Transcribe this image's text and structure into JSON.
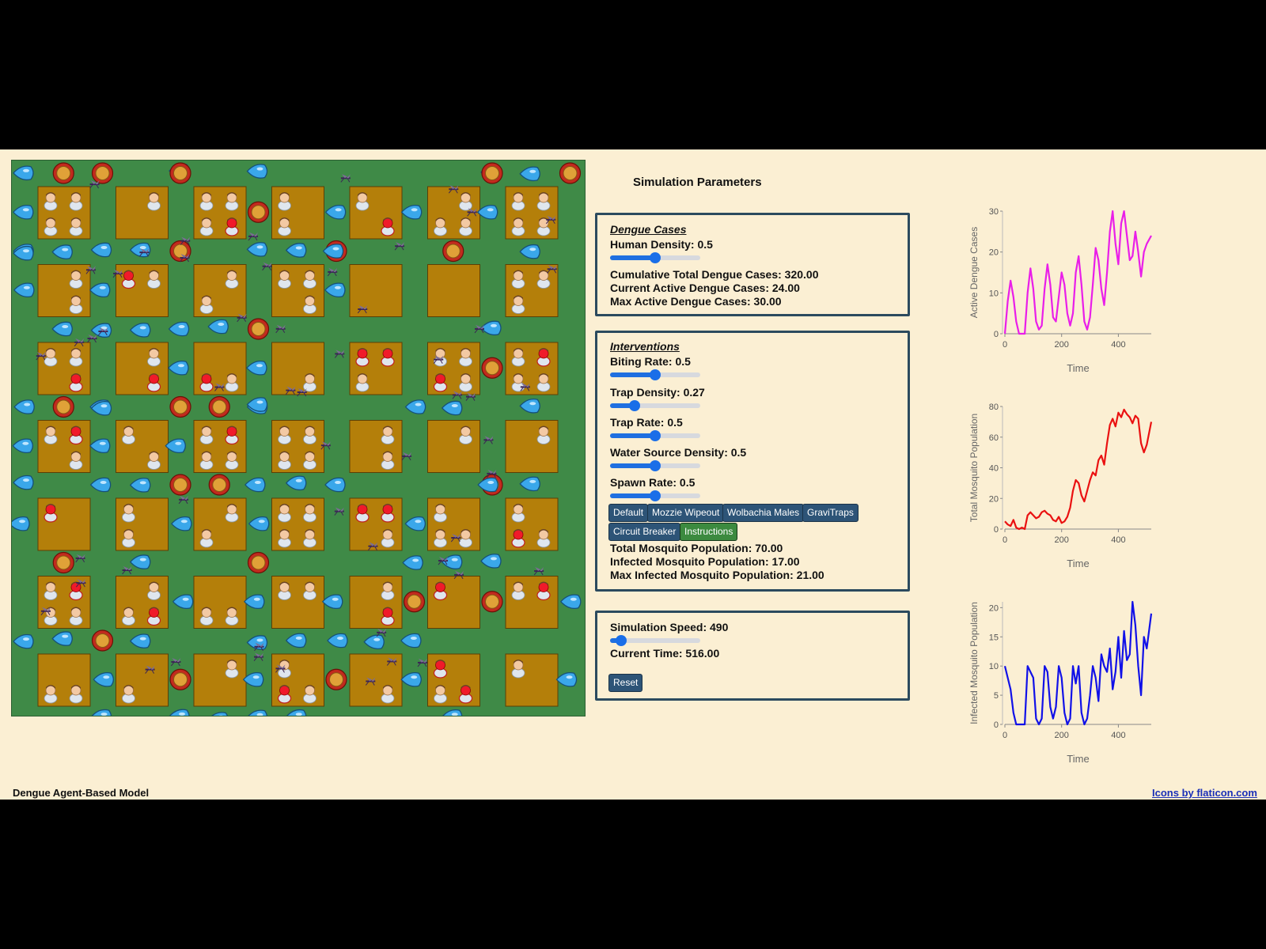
{
  "simulation_title": "Simulation Parameters",
  "dengue_cases": {
    "title": "Dengue Cases",
    "human_density": {
      "label": "Human Density: 0.5",
      "value": 0.5
    },
    "cumulative": "Cumulative Total Dengue Cases: 320.00",
    "active": "Current Active Dengue Cases: 24.00",
    "max_active": "Max Active Dengue Cases: 30.00"
  },
  "interventions": {
    "title": "Interventions",
    "biting_rate": {
      "label": "Biting Rate: 0.5",
      "value": 0.5
    },
    "trap_density": {
      "label": "Trap Density: 0.27",
      "value": 0.27
    },
    "trap_rate": {
      "label": "Trap Rate: 0.5",
      "value": 0.5
    },
    "water_source_density": {
      "label": "Water Source Density: 0.5",
      "value": 0.5
    },
    "spawn_rate": {
      "label": "Spawn Rate: 0.5",
      "value": 0.5
    },
    "buttons": [
      "Default",
      "Mozzie Wipeout",
      "Wolbachia Males",
      "GraviTraps",
      "Circuit Breaker",
      "Instructions"
    ],
    "total_mosquito": "Total Mosquito Population: 70.00",
    "infected_mosquito": "Infected Mosquito Population: 17.00",
    "max_infected_mosquito": "Max Infected Mosquito Population: 21.00"
  },
  "speed_panel": {
    "speed": {
      "label": "Simulation Speed: 490",
      "fraction": 0.12
    },
    "current_time": "Current Time: 516.00",
    "reset": "Reset"
  },
  "footer": {
    "left": "Dengue Agent-Based Model",
    "right": "Icons by flaticon.com"
  },
  "colors": {
    "grass": "#3f8a47",
    "house": "#b47f0a",
    "panel_border": "#2b4a5e",
    "button": "#2d5477",
    "button_active": "#3c8a3f",
    "slider": "#1a6ee8"
  },
  "icons": [
    "person-icon",
    "infected-person-icon",
    "water-drop-icon",
    "trap-icon",
    "mosquito-icon"
  ],
  "chart_data": [
    {
      "type": "line",
      "ylabel": "Active Dengue Cases",
      "xlabel": "Time",
      "color": "#e91ee9",
      "xlim": [
        0,
        516
      ],
      "ylim": [
        0,
        30
      ],
      "xticks": [
        0,
        200,
        400
      ],
      "yticks": [
        0,
        10,
        20,
        30
      ],
      "x": [
        0,
        10,
        20,
        30,
        40,
        50,
        60,
        70,
        80,
        90,
        100,
        110,
        120,
        130,
        140,
        150,
        160,
        170,
        180,
        190,
        200,
        210,
        220,
        230,
        240,
        250,
        260,
        270,
        280,
        290,
        300,
        310,
        320,
        330,
        340,
        350,
        360,
        370,
        380,
        390,
        400,
        410,
        420,
        430,
        440,
        450,
        460,
        470,
        480,
        490,
        500,
        516
      ],
      "y": [
        0,
        8,
        13,
        9,
        3,
        0,
        0,
        0,
        10,
        16,
        11,
        3,
        1,
        2,
        11,
        17,
        12,
        4,
        3,
        9,
        15,
        12,
        5,
        2,
        5,
        15,
        19,
        12,
        3,
        1,
        4,
        12,
        21,
        18,
        11,
        7,
        15,
        25,
        30,
        22,
        17,
        27,
        30,
        24,
        18,
        19,
        25,
        20,
        14,
        20,
        22,
        24
      ]
    },
    {
      "type": "line",
      "ylabel": "Total Mosquito Population",
      "xlabel": "Time",
      "color": "#ea1111",
      "xlim": [
        0,
        516
      ],
      "ylim": [
        0,
        80
      ],
      "xticks": [
        0,
        200,
        400
      ],
      "yticks": [
        0,
        20,
        40,
        60,
        80
      ],
      "x": [
        0,
        10,
        20,
        30,
        40,
        50,
        60,
        70,
        80,
        90,
        100,
        110,
        120,
        130,
        140,
        150,
        160,
        170,
        180,
        190,
        200,
        210,
        220,
        230,
        240,
        250,
        260,
        270,
        280,
        290,
        300,
        310,
        320,
        330,
        340,
        350,
        360,
        370,
        380,
        390,
        400,
        410,
        420,
        430,
        440,
        450,
        460,
        470,
        480,
        490,
        500,
        516
      ],
      "y": [
        5,
        3,
        2,
        6,
        1,
        0,
        1,
        0,
        9,
        11,
        9,
        7,
        8,
        11,
        12,
        10,
        9,
        6,
        5,
        8,
        4,
        5,
        8,
        14,
        25,
        32,
        30,
        22,
        18,
        25,
        32,
        37,
        35,
        45,
        48,
        42,
        56,
        68,
        72,
        67,
        76,
        73,
        78,
        75,
        73,
        69,
        74,
        72,
        56,
        50,
        55,
        70
      ]
    },
    {
      "type": "line",
      "ylabel": "Infected Mosquito Population",
      "xlabel": "Time",
      "color": "#1111e8",
      "xlim": [
        0,
        516
      ],
      "ylim": [
        0,
        21
      ],
      "xticks": [
        0,
        200,
        400
      ],
      "yticks": [
        0,
        5,
        10,
        15,
        20
      ],
      "x": [
        0,
        10,
        20,
        30,
        40,
        50,
        60,
        70,
        80,
        90,
        100,
        110,
        120,
        130,
        140,
        150,
        160,
        170,
        180,
        190,
        200,
        210,
        220,
        230,
        240,
        250,
        260,
        270,
        280,
        290,
        300,
        310,
        320,
        330,
        340,
        350,
        360,
        370,
        380,
        390,
        400,
        410,
        420,
        430,
        440,
        450,
        460,
        470,
        480,
        490,
        500,
        516
      ],
      "y": [
        10,
        8,
        6,
        2,
        0,
        0,
        0,
        0,
        10,
        9,
        8,
        1,
        0,
        1,
        10,
        9,
        3,
        1,
        3,
        10,
        8,
        2,
        0,
        1,
        10,
        7,
        10,
        2,
        0,
        1,
        5,
        10,
        8,
        4,
        12,
        10,
        9,
        13,
        6,
        9,
        15,
        8,
        16,
        11,
        12,
        21,
        17,
        10,
        5,
        15,
        13,
        19
      ]
    }
  ]
}
